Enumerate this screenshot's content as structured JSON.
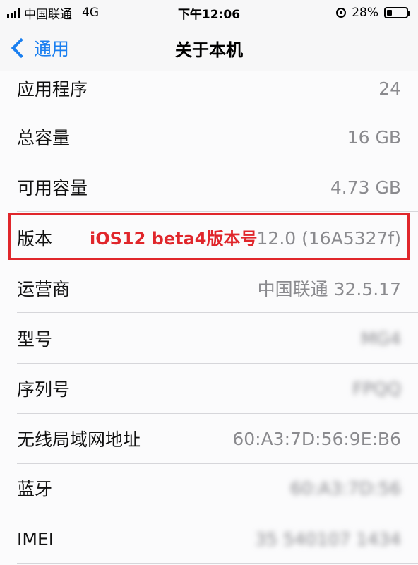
{
  "status_bar": {
    "carrier": "中国联通",
    "network": "4G",
    "time": "下午12:06",
    "battery_percent": "28%",
    "battery_level": 0.28
  },
  "nav": {
    "back_label": "通用",
    "title": "关于本机"
  },
  "rows": [
    {
      "label": "应用程序",
      "value": "24"
    },
    {
      "label": "总容量",
      "value": "16 GB"
    },
    {
      "label": "可用容量",
      "value": "4.73 GB"
    },
    {
      "label": "版本",
      "value": "12.0 (16A5327f)"
    },
    {
      "label": "运营商",
      "value": "中国联通 32.5.17"
    },
    {
      "label": "型号",
      "value": "MG4"
    },
    {
      "label": "序列号",
      "value": "FPQQ"
    },
    {
      "label": "无线局域网地址",
      "value": "60:A3:7D:56:9E:B6"
    },
    {
      "label": "蓝牙",
      "value": "60:A3:7D:56"
    },
    {
      "label": "IMEI",
      "value": "35 540107 1434"
    }
  ],
  "annotation": {
    "text": "iOS12 beta4版本号",
    "color": "#e0262b"
  }
}
